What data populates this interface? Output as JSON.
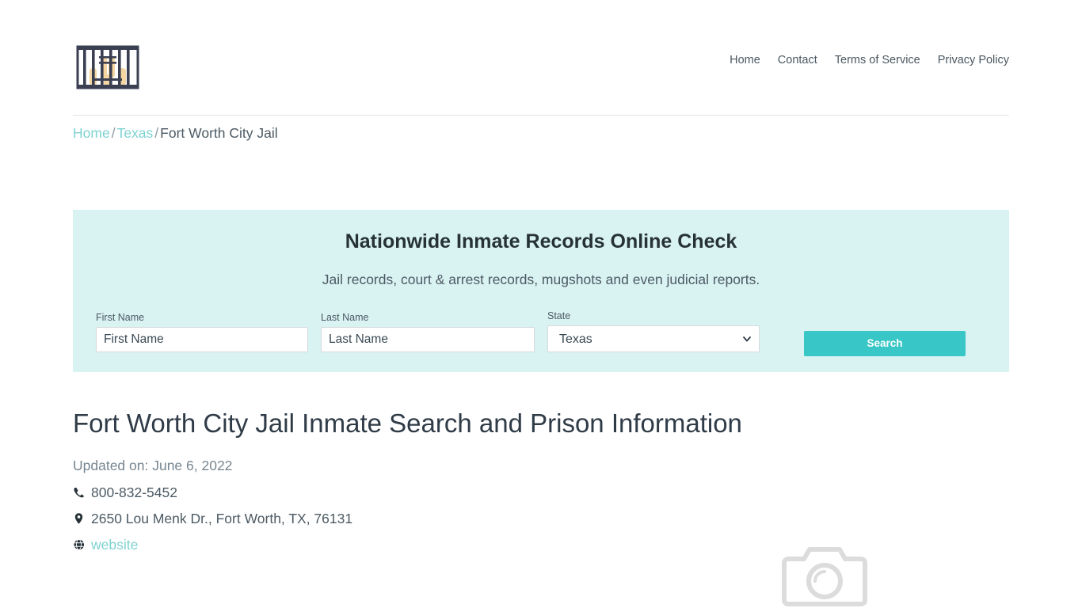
{
  "header": {
    "logo_name": "jail-bars-logo",
    "nav": [
      {
        "label": "Home"
      },
      {
        "label": "Contact"
      },
      {
        "label": "Terms of Service"
      },
      {
        "label": "Privacy Policy"
      }
    ]
  },
  "breadcrumb": {
    "home": "Home",
    "state": "Texas",
    "current": "Fort Worth City Jail",
    "separator": "/"
  },
  "search_panel": {
    "title": "Nationwide Inmate Records Online Check",
    "subtitle": "Jail records, court & arrest records, mugshots and even judicial reports.",
    "first_name": {
      "label": "First Name",
      "placeholder": "First Name",
      "value": ""
    },
    "last_name": {
      "label": "Last Name",
      "placeholder": "Last Name",
      "value": ""
    },
    "state": {
      "label": "State",
      "selected": "Texas",
      "options": [
        "Texas"
      ]
    },
    "search_button": "Search",
    "panel_bg_color": "#d9f2f2",
    "button_color": "#38c6c6"
  },
  "main": {
    "title": "Fort Worth City Jail Inmate Search and Prison Information",
    "updated": "Updated on: June 6, 2022",
    "phone": "800-832-5452",
    "address": "2650 Lou Menk Dr., Fort Worth, TX, 76131",
    "website_label": "website",
    "link_color": "#7fd2d2",
    "photo_placeholder": "camera-icon"
  }
}
